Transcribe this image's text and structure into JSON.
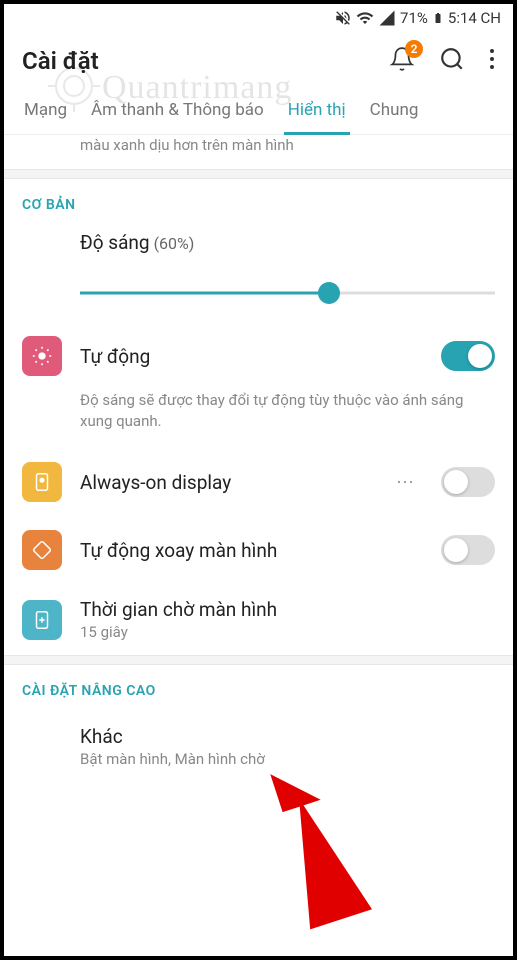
{
  "status_bar": {
    "battery_pct": "71%",
    "time": "5:14 CH"
  },
  "header": {
    "title": "Cài đặt",
    "notification_count": "2"
  },
  "tabs": {
    "items": [
      {
        "label": "Mạng",
        "active": false
      },
      {
        "label": "Âm thanh & Thông báo",
        "active": false
      },
      {
        "label": "Hiển thị",
        "active": true
      },
      {
        "label": "Chung",
        "active": false
      }
    ]
  },
  "partial_item": {
    "text_tail": "màu xanh dịu hơn trên màn hình"
  },
  "sections": {
    "basic": {
      "header": "CƠ BẢN",
      "brightness": {
        "label": "Độ sáng",
        "pct_text": "(60%)",
        "value": 60
      },
      "auto": {
        "label": "Tự động",
        "desc": "Độ sáng sẽ được thay đổi tự động tùy thuộc vào ánh sáng xung quanh.",
        "enabled": true
      },
      "always_on": {
        "label": "Always-on display",
        "enabled": false
      },
      "auto_rotate": {
        "label": "Tự động xoay màn hình",
        "enabled": false
      },
      "screen_timeout": {
        "label": "Thời gian chờ màn hình",
        "value": "15 giây"
      }
    },
    "advanced": {
      "header": "CÀI ĐẶT NÂNG CAO",
      "other": {
        "label": "Khác",
        "sub": "Bật màn hình, Màn hình chờ"
      }
    }
  },
  "watermark": "Quantrimang"
}
